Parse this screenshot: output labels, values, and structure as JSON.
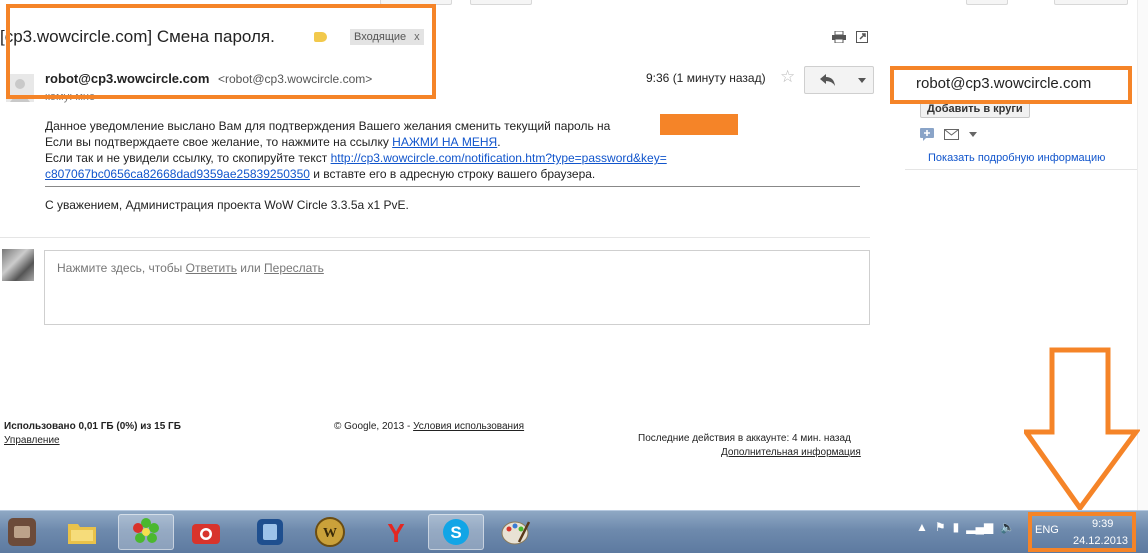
{
  "email": {
    "subject": "[cp3.wowcircle.com] Смена пароля.",
    "label": "Входящие",
    "label_remove": "x",
    "sender_name": "robot@cp3.wowcircle.com",
    "sender_email": "<robot@cp3.wowcircle.com>",
    "recipient": "кому: мне",
    "time": "9:36 (1 минуту назад)",
    "body": {
      "line1": "Данное уведомление выслано Вам для подтверждения Вашего желания сменить текущий пароль на",
      "line2_text": "Если вы подтверждаете свое желание, то нажмите на ссылку ",
      "line2_link": "НАЖМИ НА МЕНЯ",
      "line2_end": ".",
      "line3_text": "Если так и не увидели ссылку, то скопируйте текст ",
      "line3_link": "http://cp3.wowcircle.com/notification.htm?type=password&key=",
      "line4_link": "c807067bc0656ca82668dad9359ae25839250350",
      "line4_text": " и вставте его в адресную строку вашего браузера.",
      "signature": "С уважением, Администрация проекта WoW Circle 3.3.5a x1 PvE."
    },
    "reply_box": {
      "prompt": "Нажмите здесь, чтобы ",
      "reply_link": "Ответить",
      "or": " или ",
      "forward_link": "Переслать"
    }
  },
  "footer": {
    "storage": "Использовано 0,01 ГБ (0%) из 15 ГБ",
    "manage": "Управление",
    "copyright": "© Google, 2013 - ",
    "terms": "Условия использования",
    "last_activity": "Последние действия в аккаунте: 4 мин. назад",
    "details": "Дополнительная информация"
  },
  "sidebar": {
    "contact_name": "robot@cp3.wowcircle.com",
    "add_to_circles": "Добавить в круги",
    "show_details": "Показать подробную информацию"
  },
  "taskbar": {
    "language": "ENG",
    "time": "9:39",
    "date": "24.12.2013"
  },
  "colors": {
    "annotation": "#f58428",
    "link": "#1155cc"
  }
}
